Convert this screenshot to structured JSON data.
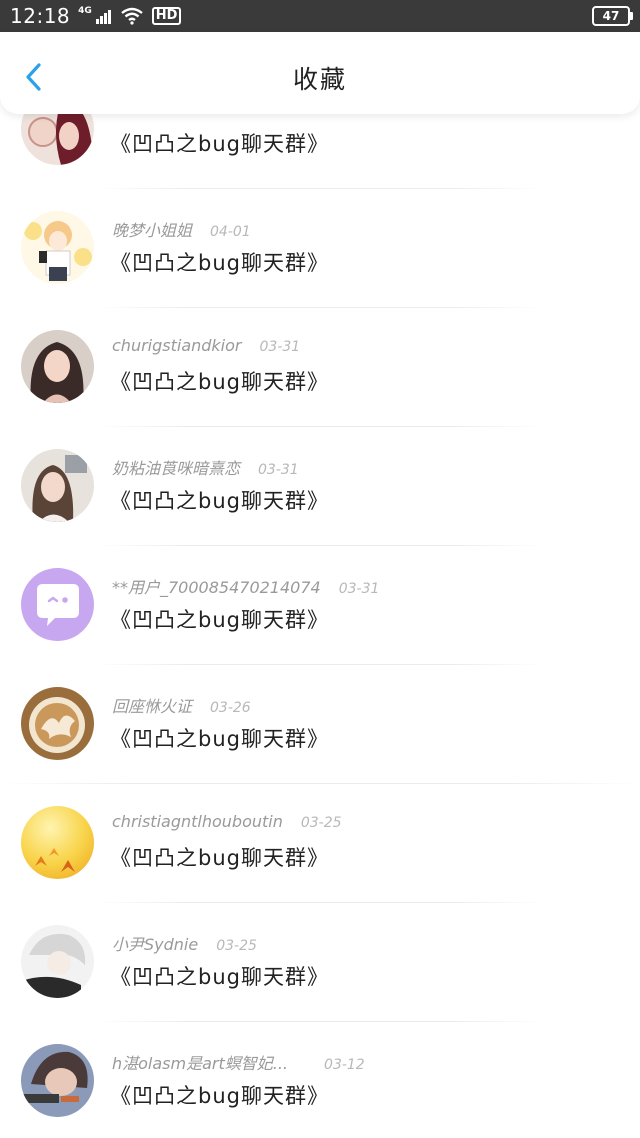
{
  "status_bar": {
    "time": "12:18",
    "network": "4G",
    "hd_label": "HD",
    "battery": "47"
  },
  "header": {
    "title": "收藏",
    "back_icon": "chevron-left-icon",
    "accent": "#2aa1e8"
  },
  "items": [
    {
      "name": "",
      "date": "",
      "message": "《凹凸之bug聊天群》",
      "avatar_colors": [
        "#e7c8b8",
        "#7a2530"
      ]
    },
    {
      "name": "晚梦小姐姐",
      "date": "04-01",
      "message": "《凹凸之bug聊天群》",
      "avatar_colors": [
        "#fbe08a",
        "#f6c98a"
      ]
    },
    {
      "name": "churigstiandkior",
      "date": "03-31",
      "message": "《凹凸之bug聊天群》",
      "avatar_colors": [
        "#c9a79a",
        "#3a2b28"
      ]
    },
    {
      "name": "奶粘油莨咪暗熹恋",
      "date": "03-31",
      "message": "《凹凸之bug聊天群》",
      "avatar_colors": [
        "#d8c4c0",
        "#5a4438"
      ]
    },
    {
      "name": "**用户_700085470214074",
      "date": "03-31",
      "message": "《凹凸之bug聊天群》",
      "avatar_colors": [
        "#c7a8f0",
        "#c7a8f0"
      ]
    },
    {
      "name": "回座恘火证",
      "date": "03-26",
      "message": "《凹凸之bug聊天群》",
      "avatar_colors": [
        "#b88a4e",
        "#f2e6d0"
      ]
    },
    {
      "name": "christiagntlhouboutin",
      "date": "03-25",
      "message": "《凹凸之bug聊天群》",
      "avatar_colors": [
        "#f8d44a",
        "#f29a22"
      ]
    },
    {
      "name": "小尹Sydnie",
      "date": "03-25",
      "message": "《凹凸之bug聊天群》",
      "avatar_colors": [
        "#e2e2e2",
        "#2a2a2a"
      ]
    },
    {
      "name": "h湛olasm是art螟智妃...",
      "date": "03-12",
      "message": "《凹凸之bug聊天群》",
      "avatar_colors": [
        "#8a9ab8",
        "#e8c8b8"
      ]
    }
  ]
}
